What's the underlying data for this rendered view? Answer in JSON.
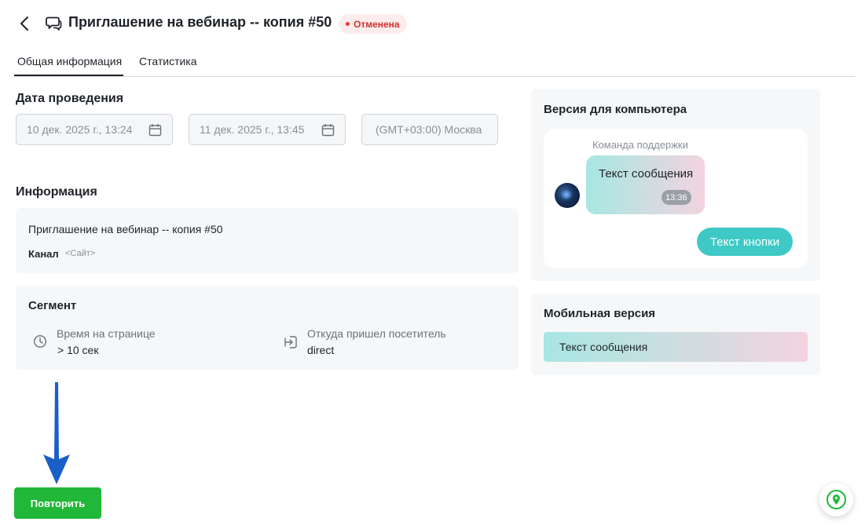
{
  "header": {
    "title": "Приглашение на вебинар -- копия #50",
    "status": "Отменена",
    "back_icon": "chevron-left-icon",
    "title_icon": "chat-bubble-icon"
  },
  "tabs": [
    {
      "label": "Общая информация",
      "active": true
    },
    {
      "label": "Статистика",
      "active": false
    }
  ],
  "schedule": {
    "title": "Дата проведения",
    "start": "10 дек. 2025 г., 13:24",
    "end": "11 дек. 2025 г., 13:45",
    "timezone": "(GMT+03:00) Москва"
  },
  "information": {
    "title": "Информация",
    "name": "Приглашение на вебинар -- копия #50",
    "channel_label": "Канал",
    "channel_value": "<Сайт>"
  },
  "segment": {
    "title": "Сегмент",
    "items": [
      {
        "label": "Время на странице",
        "value": "> 10 сек",
        "icon": "clock-icon"
      },
      {
        "label": "Откуда пришел посетитель",
        "value": "direct",
        "icon": "enter-icon"
      }
    ]
  },
  "desktop_preview": {
    "title": "Версия для компьютера",
    "sender": "Команда поддержки",
    "message": "Текст сообщения",
    "time": "13:36",
    "button": "Текст кнопки"
  },
  "mobile_preview": {
    "title": "Мобильная версия",
    "message": "Текст сообщения"
  },
  "actions": {
    "repeat": "Повторить"
  },
  "colors": {
    "primary_button": "#21b83a",
    "status_badge_bg": "#fdecec",
    "status_badge_text": "#d32f2f",
    "preview_button": "#3ec9c6",
    "arrow": "#1a5fc8"
  }
}
